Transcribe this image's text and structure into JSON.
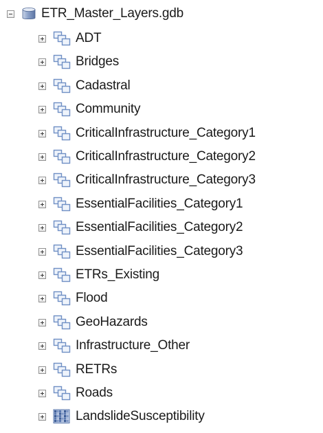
{
  "tree": {
    "root": {
      "label": "ETR_Master_Layers.gdb",
      "expanded": true,
      "icon": "file-geodatabase-icon"
    },
    "items": [
      {
        "label": "ADT",
        "icon": "feature-dataset-icon"
      },
      {
        "label": "Bridges",
        "icon": "feature-dataset-icon"
      },
      {
        "label": "Cadastral",
        "icon": "feature-dataset-icon"
      },
      {
        "label": "Community",
        "icon": "feature-dataset-icon"
      },
      {
        "label": "CriticalInfrastructure_Category1",
        "icon": "feature-dataset-icon"
      },
      {
        "label": "CriticalInfrastructure_Category2",
        "icon": "feature-dataset-icon"
      },
      {
        "label": "CriticalInfrastructure_Category3",
        "icon": "feature-dataset-icon"
      },
      {
        "label": "EssentialFacilities_Category1",
        "icon": "feature-dataset-icon"
      },
      {
        "label": "EssentialFacilities_Category2",
        "icon": "feature-dataset-icon"
      },
      {
        "label": "EssentialFacilities_Category3",
        "icon": "feature-dataset-icon"
      },
      {
        "label": "ETRs_Existing",
        "icon": "feature-dataset-icon"
      },
      {
        "label": "Flood",
        "icon": "feature-dataset-icon"
      },
      {
        "label": "GeoHazards",
        "icon": "feature-dataset-icon"
      },
      {
        "label": "Infrastructure_Other",
        "icon": "feature-dataset-icon"
      },
      {
        "label": "RETRs",
        "icon": "feature-dataset-icon"
      },
      {
        "label": "Roads",
        "icon": "feature-dataset-icon"
      },
      {
        "label": "LandslideSusceptibility",
        "icon": "raster-dataset-icon"
      }
    ]
  },
  "colors": {
    "text": "#1a1a1a",
    "dataset_icon": "#6f8fc4",
    "geodatabase_icon": "#8aa0c8",
    "raster_icon": "#4f6fa8"
  }
}
